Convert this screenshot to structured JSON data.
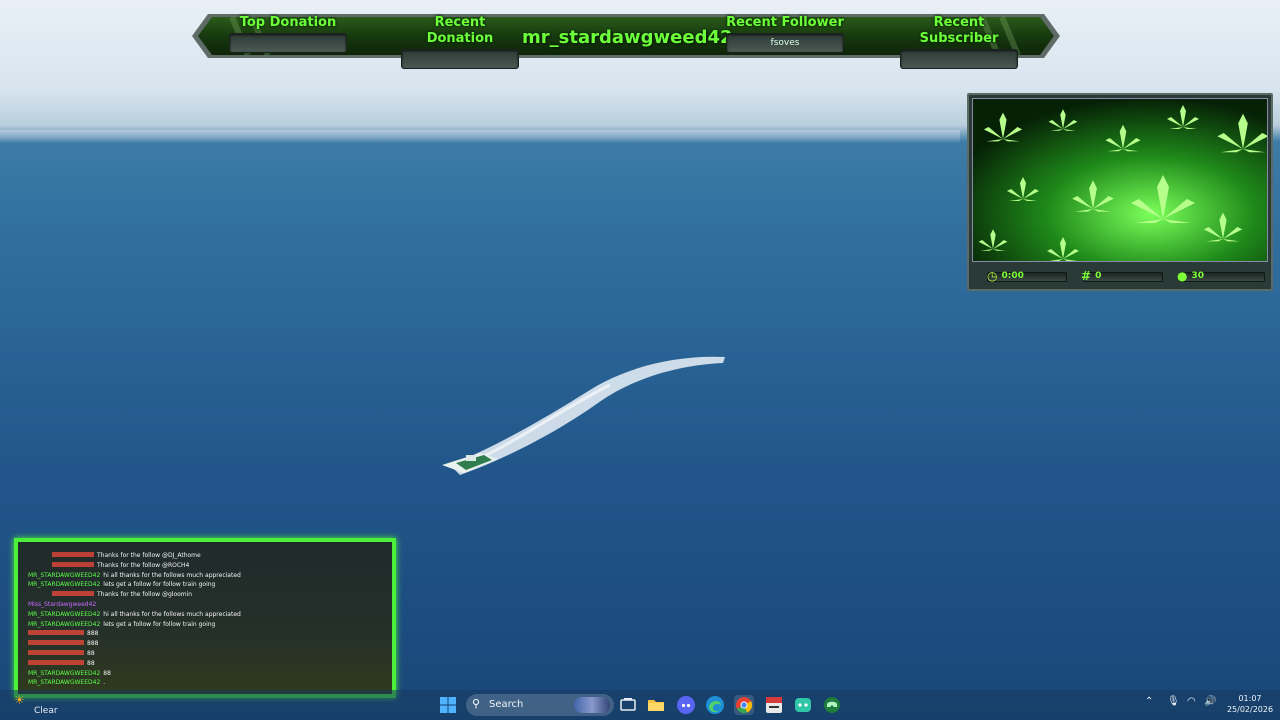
{
  "overlay": {
    "top_donation": {
      "label": "Top Donation",
      "value": ""
    },
    "recent_donation": {
      "label": "Recent Donation",
      "value": ""
    },
    "channel_name": "mr_stardawgweed42",
    "recent_follower": {
      "label": "Recent Follower",
      "value": "fsoves"
    },
    "recent_subscriber": {
      "label": "Recent Subscriber",
      "value": ""
    }
  },
  "cam_panel": {
    "uptime": "0:00",
    "hashtag_count": "0",
    "viewer_count": "30"
  },
  "chat": {
    "lines": [
      {
        "user": "",
        "user_color": "red",
        "text": "Thanks for the follow @DJ_Athome"
      },
      {
        "user": "",
        "user_color": "red",
        "text": "Thanks for the follow @ROCH4"
      },
      {
        "user": "MR_STARDAWGWEED42",
        "user_color": "green",
        "text": "hi all thanks for the follows much appreciated"
      },
      {
        "user": "MR_STARDAWGWEED42",
        "user_color": "green",
        "text": "lets get a follow for follow train going"
      },
      {
        "user": "",
        "user_color": "red",
        "text": "Thanks for the follow @gloomin"
      },
      {
        "user": "Miss_Stardawgweed42",
        "user_color": "purple",
        "text": ""
      },
      {
        "user": "MR_STARDAWGWEED42",
        "user_color": "green",
        "text": "hi all thanks for the follows much appreciated"
      },
      {
        "user": "MR_STARDAWGWEED42",
        "user_color": "green",
        "text": "lets get a follow for follow train going"
      },
      {
        "user": "",
        "user_color": "red",
        "text": "888"
      },
      {
        "user": "",
        "user_color": "red",
        "text": "888"
      },
      {
        "user": "",
        "user_color": "red",
        "text": "88"
      },
      {
        "user": "",
        "user_color": "red",
        "text": "88"
      },
      {
        "user": "MR_STARDAWGWEED42",
        "user_color": "green",
        "text": "88"
      },
      {
        "user": "MR_STARDAWGWEED42",
        "user_color": "green",
        "text": "."
      }
    ],
    "colors": {
      "green": "#5dff4a",
      "red": "#ff4a3a",
      "purple": "#c86aff"
    }
  },
  "taskbar": {
    "weather": {
      "icon": "sun-icon",
      "text": "Clear"
    },
    "search_placeholder": "Search",
    "apps": [
      {
        "name": "start-button",
        "icon": "windows-icon"
      },
      {
        "name": "task-view-icon",
        "icon": "task-view-icon"
      },
      {
        "name": "file-explorer-icon",
        "icon": "folder-icon"
      },
      {
        "name": "discord-icon",
        "icon": "discord-icon"
      },
      {
        "name": "edge-icon",
        "icon": "edge-icon"
      },
      {
        "name": "chrome-icon",
        "icon": "chrome-icon"
      },
      {
        "name": "streamlabs-icon",
        "icon": "streamlabs-icon"
      },
      {
        "name": "bot-app-icon",
        "icon": "bot-icon"
      },
      {
        "name": "gamepad-app-icon",
        "icon": "gamepad-icon"
      }
    ],
    "clock": {
      "time": "01:07",
      "date": "25/02/2026"
    }
  },
  "accent": "#6cff3a"
}
